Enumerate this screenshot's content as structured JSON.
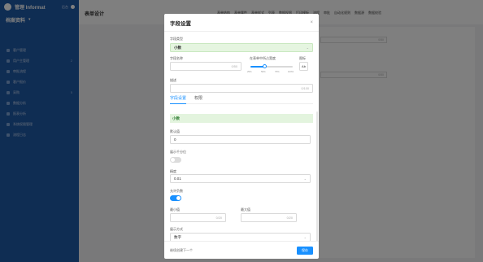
{
  "app": {
    "brand": "管理 Informat",
    "brand_tag": "后台",
    "module": "档案资料",
    "module_caret": "▾",
    "menu": [
      {
        "label": "客户管理",
        "count": ""
      },
      {
        "label": "用户主管理",
        "count": "2"
      },
      {
        "label": "审批流程",
        "count": ""
      },
      {
        "label": "客户报价",
        "count": ""
      },
      {
        "label": "采购",
        "count": "5"
      },
      {
        "label": "数据分析",
        "count": ""
      },
      {
        "label": "报表分析",
        "count": ""
      },
      {
        "label": "系统权限管理",
        "count": ""
      },
      {
        "label": "流程日志",
        "count": ""
      }
    ],
    "page_title": "表单设计",
    "top_tabs": [
      "表单结构",
      "表单属性",
      "表单样式",
      "列表",
      "数据权限",
      "打印模板",
      "流程",
      "审批",
      "自动化规则",
      "数据源",
      "数据校验"
    ],
    "bg_field_values": [
      "0/50",
      "0/50"
    ]
  },
  "modal": {
    "title": "字段设置",
    "close_icon": "×",
    "field_type_label": "字段类型",
    "field_type_value": "小数",
    "field_name_label": "字段名称",
    "field_name_count": "0/50",
    "width_label": "在表单中所占宽度",
    "width_ticks": [
      "25%",
      "50%",
      "75%",
      "100%"
    ],
    "width_value": 0.33,
    "icon_label": "图标",
    "icon_btn": "Ab",
    "desc_label": "描述",
    "desc_count": "0/100",
    "tabs": [
      "字段设置",
      "权限"
    ],
    "banner": "小数",
    "default_label": "默认值",
    "default_value": "0",
    "show_thousands_label": "展示千分位",
    "show_thousands_on": false,
    "precision_label": "精度",
    "precision_value": "0.01",
    "allow_negative_label": "允许负数",
    "allow_negative_on": true,
    "min_label": "最小值",
    "min_count": "0/20",
    "max_label": "最大值",
    "max_count": "0/20",
    "display_label": "展示方式",
    "display_value": "数字",
    "footer_left": "继续创建下一个",
    "save_btn": "保存"
  },
  "colors": {
    "primary": "#1890ff",
    "sidebar": "#1f5aa6",
    "banner_bg": "#e3f4de"
  }
}
